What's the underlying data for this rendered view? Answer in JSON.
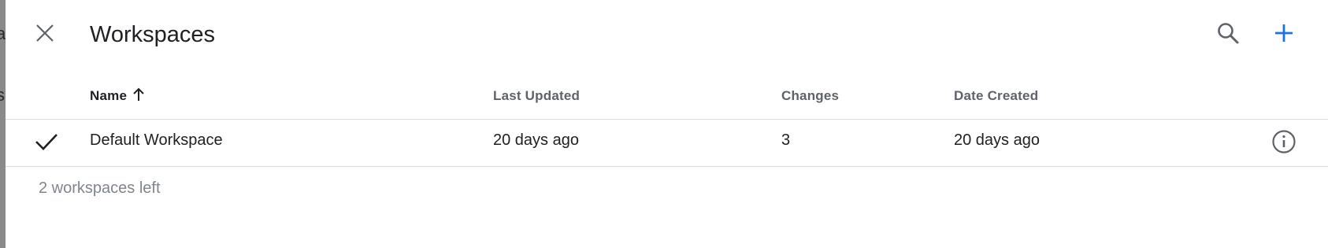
{
  "background_fragments": [
    "a",
    "s"
  ],
  "header": {
    "title": "Workspaces",
    "close_icon": "close-icon",
    "search_icon": "search-icon",
    "add_icon": "add-icon",
    "accent_color": "#1a73e8"
  },
  "table": {
    "columns": [
      {
        "label": "Name",
        "sorted": "ascending"
      },
      {
        "label": "Last Updated"
      },
      {
        "label": "Changes"
      },
      {
        "label": "Date Created"
      }
    ],
    "rows": [
      {
        "selected": true,
        "name": "Default Workspace",
        "last_updated": "20 days ago",
        "changes": "3",
        "date_created": "20 days ago"
      }
    ]
  },
  "footer": {
    "remaining_text": "2 workspaces left"
  }
}
